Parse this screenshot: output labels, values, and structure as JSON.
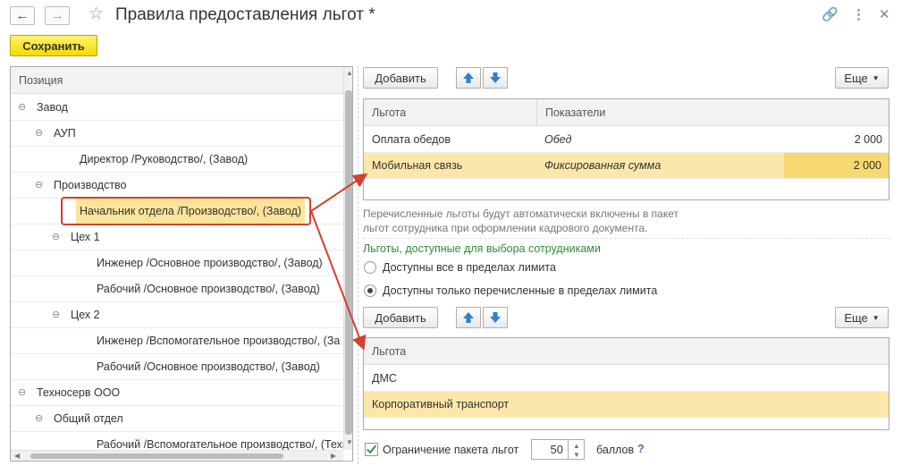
{
  "window": {
    "title": "Правила предоставления льгот *",
    "back_icon": "arrow-left-icon",
    "forward_icon": "arrow-right-icon"
  },
  "toolbar": {
    "save_label": "Сохранить"
  },
  "tree": {
    "header": "Позиция",
    "rows": [
      {
        "label": "Завод",
        "expander": "⊖"
      },
      {
        "label": "АУП",
        "expander": "⊖"
      },
      {
        "label": "Директор /Руководство/, (Завод)",
        "expander": ""
      },
      {
        "label": "Производство",
        "expander": "⊖"
      },
      {
        "label": "Начальник отдела /Производство/, (Завод)",
        "expander": ""
      },
      {
        "label": "Цех 1",
        "expander": "⊖"
      },
      {
        "label": "Инженер /Основное производство/, (Завод)",
        "expander": ""
      },
      {
        "label": "Рабочий /Основное производство/, (Завод)",
        "expander": ""
      },
      {
        "label": "Цех 2",
        "expander": "⊖"
      },
      {
        "label": "Инженер /Вспомогательное производство/, (За",
        "expander": ""
      },
      {
        "label": "Рабочий /Основное производство/, (Завод)",
        "expander": ""
      },
      {
        "label": "Техносерв ООО",
        "expander": "⊖"
      },
      {
        "label": "Общий отдел",
        "expander": "⊖"
      },
      {
        "label": "Рабочий /Вспомогательное производство/, (Техно",
        "expander": ""
      }
    ]
  },
  "top_panel": {
    "add_label": "Добавить",
    "more_label": "Еще",
    "columns": [
      "Льгота",
      "Показатели"
    ],
    "rows": [
      {
        "benefit": "Оплата обедов",
        "indicator": "Обед",
        "value": "2 000"
      },
      {
        "benefit": "Мобильная связь",
        "indicator": "Фиксированная сумма",
        "value": "2 000"
      }
    ]
  },
  "info": {
    "line1": "Перечисленные льготы будут автоматически включены в пакет",
    "line2": "льгот сотрудника при оформлении кадрового документа."
  },
  "choice": {
    "title": "Льготы, доступные для выбора сотрудниками",
    "option1": "Доступны все в пределах лимита",
    "option2": "Доступны только перечисленные в пределах лимита"
  },
  "bottom_panel": {
    "add_label": "Добавить",
    "more_label": "Еще",
    "column": "Льгота",
    "rows": [
      "ДМС",
      "Корпоративный транспорт"
    ]
  },
  "limit": {
    "label": "Ограничение пакета льгот",
    "value": "50",
    "unit": "баллов",
    "help": "?"
  },
  "colors": {
    "save_button": "#f2db00",
    "selection": "#fbe7a9",
    "callout": "#d2412f",
    "group_title": "#2e8b3a"
  }
}
